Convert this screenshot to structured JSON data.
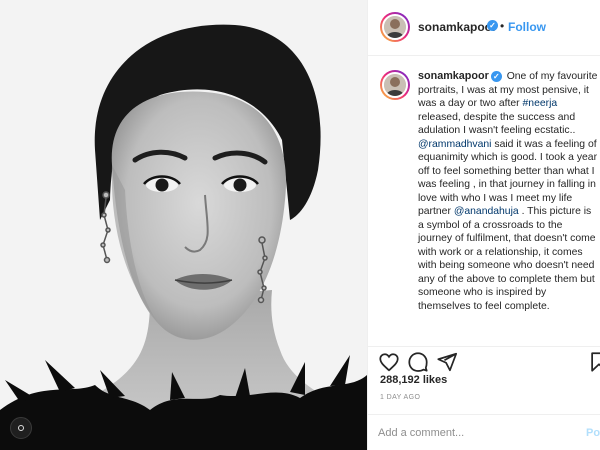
{
  "post": {
    "username": "sonamkapoor",
    "verified_icon": "verified-badge-icon",
    "follow_label": "Follow",
    "separator": "•",
    "caption": {
      "p1": "One of my favourite portraits, I was at my most pensive, it was a day or two after ",
      "hashtag": "#neerja",
      "p2": " released, despite the success and adulation I wasn't feeling ecstatic.. ",
      "mention1": "@rammadhvani",
      "p3": " said it was a feeling of equanimity which is good. I took a year off to feel something better than what I was feeling , in that journey in falling in love with who I was I meet my life partner ",
      "mention2": "@anandahuja",
      "p4": " . This picture is a symbol of a crossroads to the journey of fulfilment, that doesn't come with work or a relationship, it comes with being someone who doesn't need any of the above to complete them but someone who is inspired by themselves to feel complete."
    },
    "likes": "288,192 likes",
    "time_ago": "1 DAY AGO",
    "comment_placeholder": "Add a comment...",
    "post_label": "Post",
    "icons": [
      "heart-icon",
      "comment-icon",
      "share-icon",
      "bookmark-icon"
    ],
    "colors": {
      "accent": "#3897f0",
      "link": "#00376b",
      "muted": "#8e8e8e",
      "post_disabled": "#b2dffc"
    }
  }
}
